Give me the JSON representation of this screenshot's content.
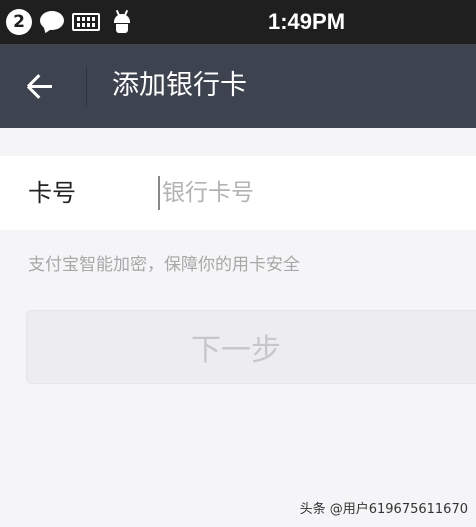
{
  "status_bar": {
    "notification_count": "2",
    "icons": [
      "notification-count-badge",
      "chat-icon",
      "keyboard-icon",
      "android-icon"
    ],
    "time": "1:49PM"
  },
  "nav": {
    "back_icon": "arrow-left-icon",
    "title": "添加银行卡"
  },
  "form": {
    "card_number_label": "卡号",
    "card_number_placeholder": "银行卡号",
    "card_number_value": "",
    "hint": "支付宝智能加密，保障你的用卡安全"
  },
  "actions": {
    "next_label": "下一步",
    "next_enabled": false
  },
  "watermark": "头条 @用户619675611670",
  "colors": {
    "status_bar_bg": "#1f1f1f",
    "nav_bg": "#3e4350",
    "page_bg": "#f5f5f7",
    "disabled_button_bg": "#ededef",
    "disabled_button_text": "#c7c7c9"
  }
}
